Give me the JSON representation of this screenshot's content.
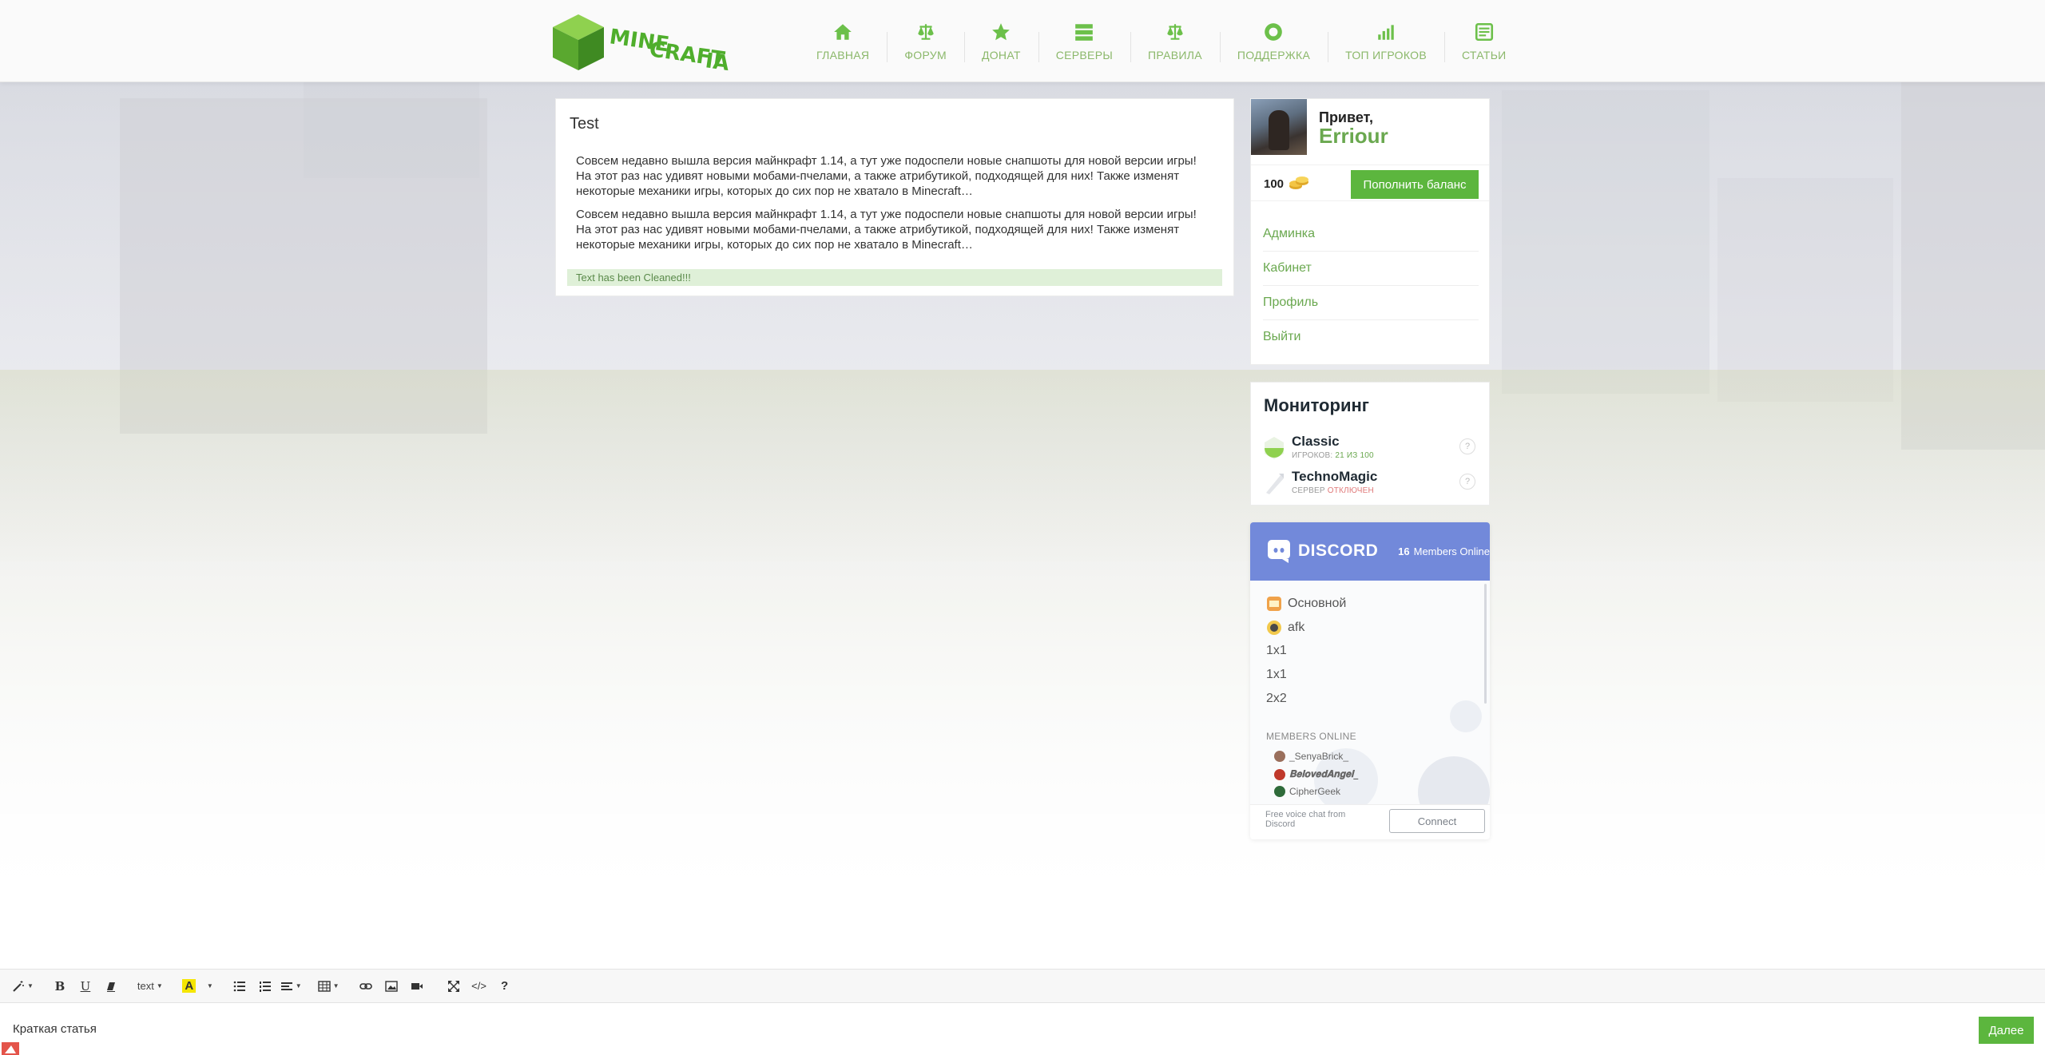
{
  "header": {
    "logo_text": [
      "MINE",
      "CRAFT",
      "IA"
    ],
    "nav": [
      {
        "label": "ГЛАВНАЯ",
        "icon": "home-icon"
      },
      {
        "label": "ФОРУМ",
        "icon": "scales-icon"
      },
      {
        "label": "ДОНАТ",
        "icon": "star-icon"
      },
      {
        "label": "СЕРВЕРЫ",
        "icon": "server-list-icon"
      },
      {
        "label": "ПРАВИЛА",
        "icon": "scales-icon"
      },
      {
        "label": "ПОДДЕРЖКА",
        "icon": "lifebuoy-icon"
      },
      {
        "label": "ТОП ИГРОКОВ",
        "icon": "chart-icon"
      },
      {
        "label": "СТАТЬИ",
        "icon": "article-icon"
      }
    ]
  },
  "article": {
    "title": "Test",
    "paragraphs": [
      "Совсем недавно вышла версия майнкрафт 1.14, а тут уже подоспели новые снапшоты для новой версии игры! На этот раз нас удивят новыми мобами-пчелами, а также атрибутикой, подходящей для них! Также изменят некоторые механики игры, которых до сих пор не хватало в Minecraft…",
      "Совсем недавно вышла версия майнкрафт 1.14, а тут уже подоспели новые снапшоты для новой версии игры! На этот раз нас удивят новыми мобами-пчелами, а также атрибутикой, подходящей для них! Также изменят некоторые механики игры, которых до сих пор не хватало в Minecraft…"
    ],
    "notice": "Text has been Cleaned!!!"
  },
  "user": {
    "greeting": "Привет,",
    "name": "Erriour",
    "balance": "100",
    "topup_label": "Пополнить баланс",
    "menu": [
      "Админка",
      "Кабинет",
      "Профиль",
      "Выйти"
    ]
  },
  "monitoring": {
    "title": "Мониторинг",
    "servers": [
      {
        "name": "Classic",
        "status_prefix": "ИГРОКОВ: ",
        "status_value": "21 ИЗ 100",
        "help": "?"
      },
      {
        "name": "TechnoMagic",
        "status_prefix": "СЕРВЕР ",
        "status_value": "ОТКЛЮЧЕН",
        "help": "?"
      }
    ]
  },
  "discord": {
    "brand": "DISCORD",
    "online_count": "16",
    "online_label": "Members Online",
    "channels": [
      {
        "name": "Основной",
        "has_icon": true
      },
      {
        "name": "afk",
        "has_icon": true
      },
      {
        "name": "1x1",
        "has_icon": false
      },
      {
        "name": "1x1",
        "has_icon": false
      },
      {
        "name": "2x2",
        "has_icon": false
      }
    ],
    "members_title": "MEMBERS ONLINE",
    "members": [
      "_SenyaBrick_",
      "𝐁𝐞𝐥𝐨𝐯𝐞𝐝𝐀𝐧𝐠𝐞𝐥_",
      "CipherGeek"
    ],
    "footer_text": "Free voice chat from Discord",
    "connect_label": "Connect"
  },
  "editor": {
    "font_label": "text",
    "description_label": "Кpaткая статья",
    "next_label": "Далее"
  },
  "colors": {
    "accent_green": "#5cb63e",
    "link_green": "#6aa84f",
    "discord_blurple": "#7289da",
    "notice_bg": "#dff0d8"
  }
}
